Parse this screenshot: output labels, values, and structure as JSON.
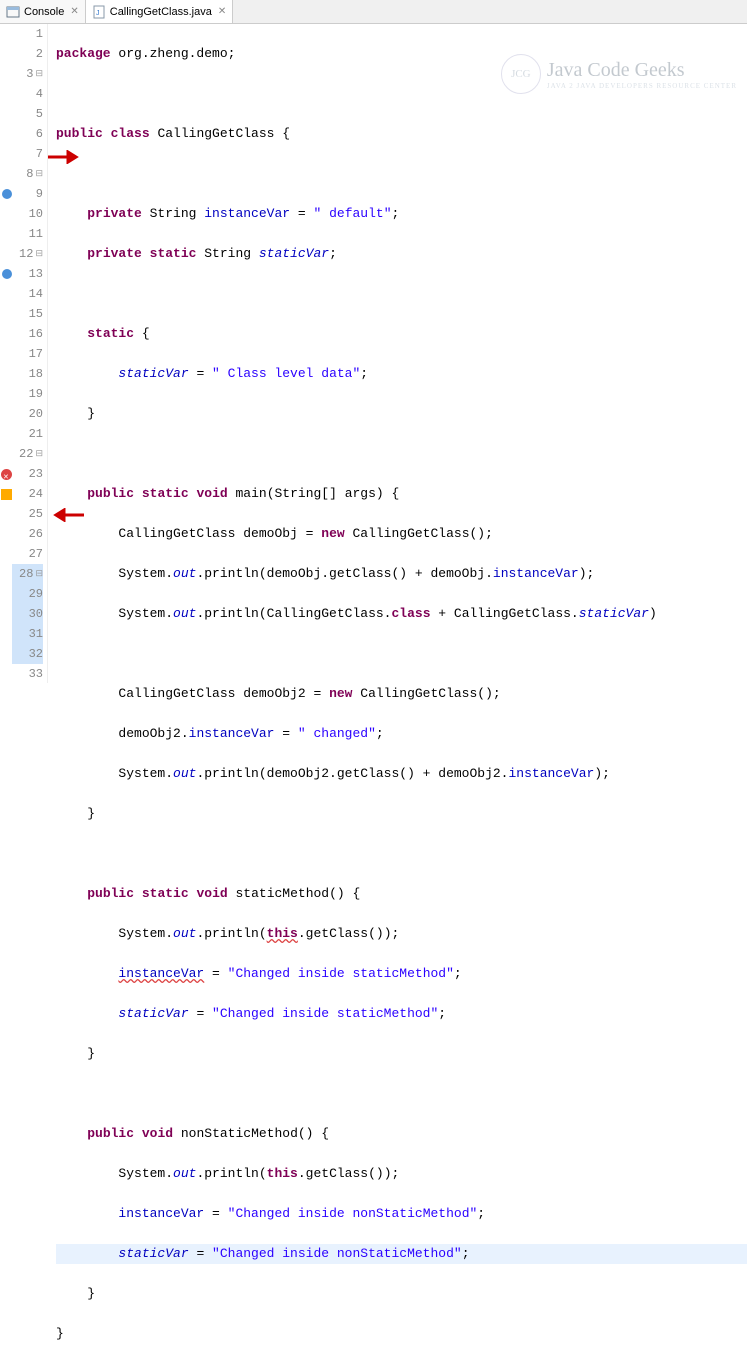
{
  "tabs": {
    "console": "Console",
    "file": "CallingGetClass.java"
  },
  "watermark": {
    "badge": "JCG",
    "main": "Java Code Geeks",
    "sub": "JAVA 2 JAVA DEVELOPERS RESOURCE CENTER"
  },
  "lines": {
    "l1a": "package",
    "l1b": " org.zheng.demo;",
    "l3a": "public",
    "l3b": " ",
    "l3c": "class",
    "l3d": " CallingGetClass {",
    "l5a": "private",
    "l5b": " String ",
    "l5c": "instanceVar",
    "l5d": " = ",
    "l5e": "\" default\"",
    "l5f": ";",
    "l6a": "private",
    "l6b": " ",
    "l6c": "static",
    "l6d": " String ",
    "l6e": "staticVar",
    "l6f": ";",
    "l8a": "static",
    "l8b": " {",
    "l9a": "staticVar",
    "l9b": " = ",
    "l9c": "\" Class level data\"",
    "l9d": ";",
    "l10": "}",
    "l12a": "public",
    "l12b": " ",
    "l12c": "static",
    "l12d": " ",
    "l12e": "void",
    "l12f": " main(String[] args) {",
    "l13a": "CallingGetClass demoObj = ",
    "l13b": "new",
    "l13c": " CallingGetClass();",
    "l14a": "System.",
    "l14b": "out",
    "l14c": ".println(demoObj.getClass() + demoObj.",
    "l14d": "instanceVar",
    "l14e": ");",
    "l15a": "System.",
    "l15b": "out",
    "l15c": ".println(CallingGetClass.",
    "l15d": "class",
    "l15e": " + CallingGetClass.",
    "l15f": "staticVar",
    "l15g": ")",
    "l17a": "CallingGetClass demoObj2 = ",
    "l17b": "new",
    "l17c": " CallingGetClass();",
    "l18a": "demoObj2.",
    "l18b": "instanceVar",
    "l18c": " = ",
    "l18d": "\" changed\"",
    "l18e": ";",
    "l19a": "System.",
    "l19b": "out",
    "l19c": ".println(demoObj2.getClass() + demoObj2.",
    "l19d": "instanceVar",
    "l19e": ");",
    "l20": "}",
    "l22a": "public",
    "l22b": " ",
    "l22c": "static",
    "l22d": " ",
    "l22e": "void",
    "l22f": " staticMethod() {",
    "l23a": "System.",
    "l23b": "out",
    "l23c": ".println(",
    "l23d": "this",
    "l23e": ".getClass());",
    "l24a": "instanceVar",
    "l24b": " = ",
    "l24c": "\"Changed inside staticMethod\"",
    "l24d": ";",
    "l25a": "staticVar",
    "l25b": " = ",
    "l25c": "\"Changed inside staticMethod\"",
    "l25d": ";",
    "l26": "}",
    "l28a": "public",
    "l28b": " ",
    "l28c": "void",
    "l28d": " nonStaticMethod() {",
    "l29a": "System.",
    "l29b": "out",
    "l29c": ".println(",
    "l29d": "this",
    "l29e": ".getClass());",
    "l30a": "instanceVar",
    "l30b": " = ",
    "l30c": "\"Changed inside nonStaticMethod\"",
    "l30d": ";",
    "l31a": "staticVar",
    "l31b": " = ",
    "l31c": "\"Changed inside nonStaticMethod\"",
    "l31d": ";",
    "l32": "}",
    "l33": "}"
  },
  "line_numbers": [
    "1",
    "2",
    "3",
    "4",
    "5",
    "6",
    "7",
    "8",
    "9",
    "10",
    "11",
    "12",
    "13",
    "14",
    "15",
    "16",
    "17",
    "18",
    "19",
    "20",
    "21",
    "22",
    "23",
    "24",
    "25",
    "26",
    "27",
    "28",
    "29",
    "30",
    "31",
    "32",
    "33"
  ]
}
